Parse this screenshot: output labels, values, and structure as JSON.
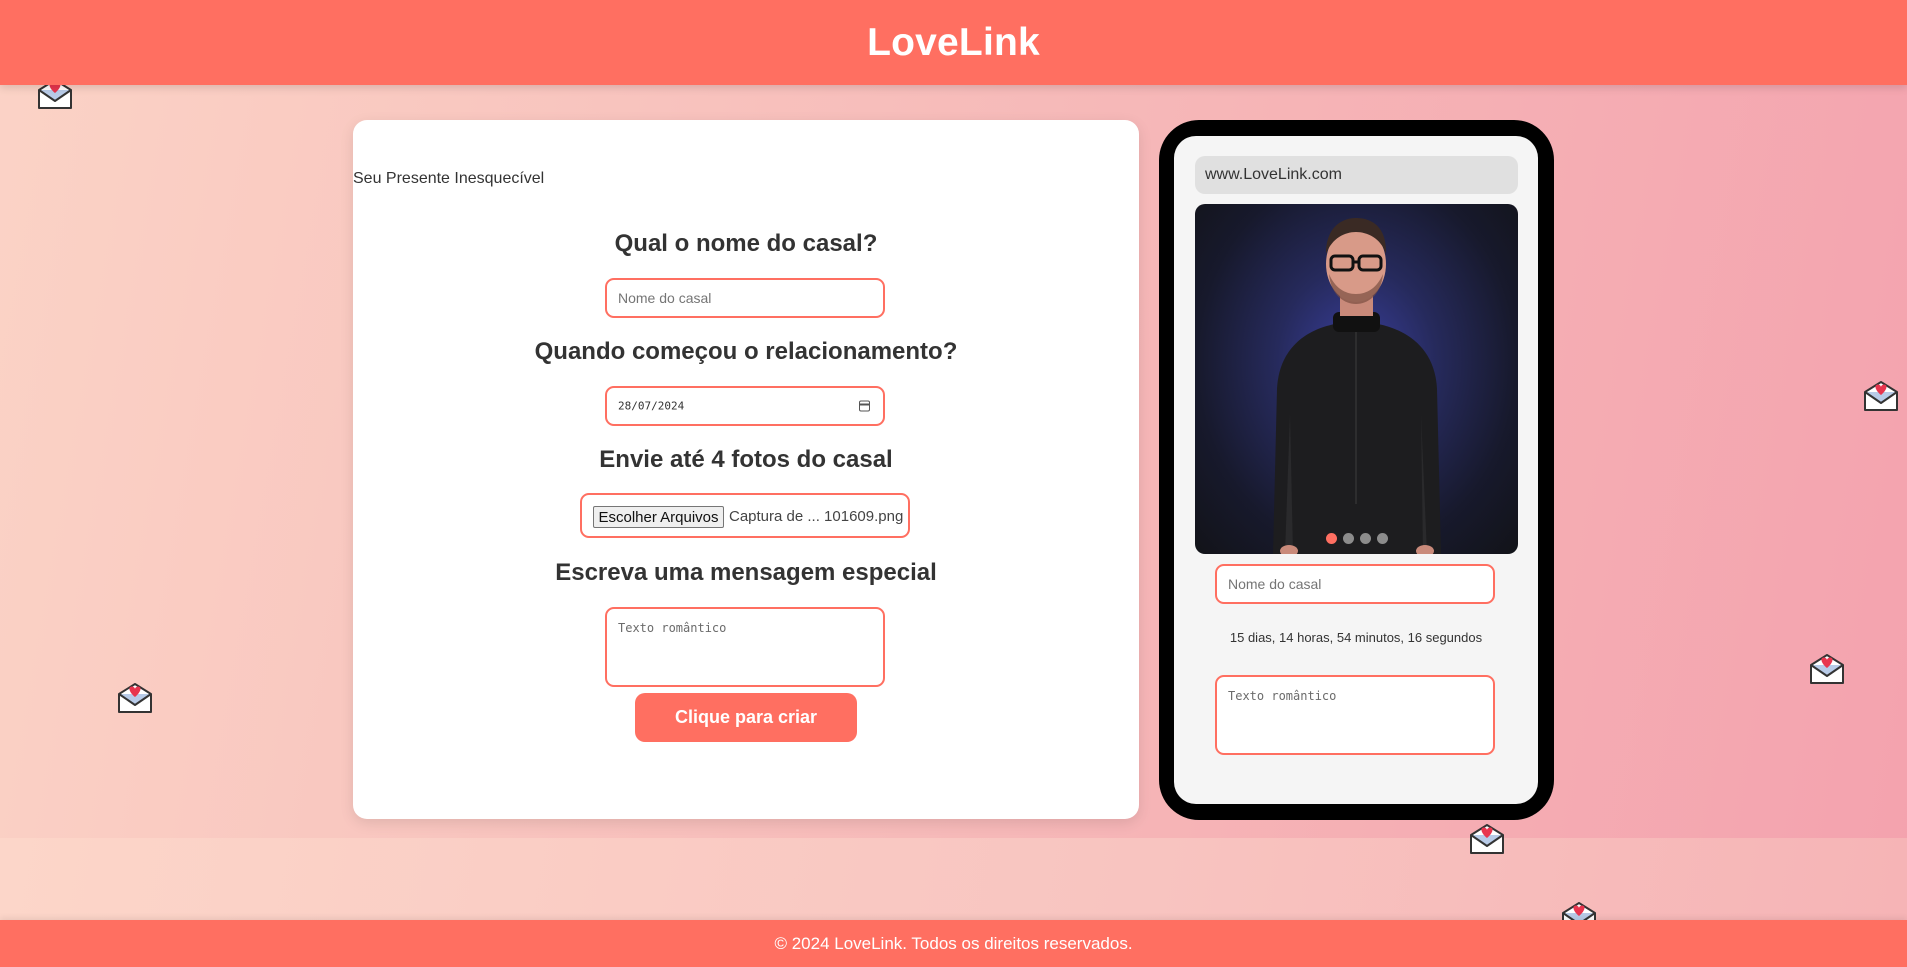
{
  "app": {
    "title": "LoveLink"
  },
  "form": {
    "title": "Seu Presente Inesquecível",
    "q_name": "Qual o nome do casal?",
    "name_placeholder": "Nome do casal",
    "q_date": "Quando começou o relacionamento?",
    "date_value": "28/07/2024",
    "q_photos": "Envie até 4 fotos do casal",
    "file_button": "Escolher Arquivos",
    "file_name": "Captura de ... 101609.png",
    "q_message": "Escreva uma mensagem especial",
    "message_placeholder": "Texto romântico",
    "submit_label": "Clique para criar"
  },
  "preview": {
    "url": "www.LoveLink.com",
    "name_placeholder": "Nome do casal",
    "counter": "15 dias, 14 horas, 54 minutos, 16 segundos",
    "message_placeholder": "Texto romântico",
    "carousel": {
      "count": 4,
      "active_index": 0
    }
  },
  "footer": {
    "text": "© 2024 LoveLink. Todos os direitos reservados."
  },
  "colors": {
    "accent": "#ff6f61",
    "card": "#ffffff",
    "phone": "#000000"
  },
  "icons": [
    "love-letter-icon",
    "calendar-icon"
  ]
}
